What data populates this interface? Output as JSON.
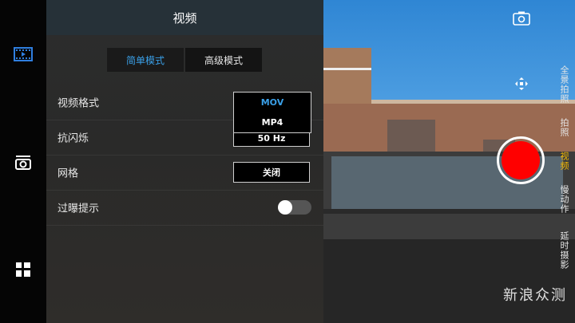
{
  "rail": {
    "items": [
      {
        "icon": "video-mode-icon"
      },
      {
        "icon": "camera-flip-icon"
      },
      {
        "icon": "grid-menu-icon"
      }
    ]
  },
  "panel": {
    "title": "视频",
    "mode_tabs": [
      {
        "label": "简单模式",
        "active": true
      },
      {
        "label": "高级模式",
        "active": false
      }
    ],
    "rows": {
      "format": {
        "label": "视频格式"
      },
      "flicker": {
        "label": "抗闪烁",
        "value": "50 Hz"
      },
      "grid": {
        "label": "网格",
        "value": "关闭"
      },
      "overexposure": {
        "label": "过曝提示",
        "toggle_on": false
      }
    },
    "format_dropdown": {
      "options": [
        "MOV",
        "MP4"
      ],
      "selected": "MOV"
    }
  },
  "camera": {
    "modes": [
      "全景拍照",
      "拍照",
      "视频",
      "慢动作",
      "延时摄影"
    ],
    "active_mode": "视频",
    "accent": "#f5b800",
    "shutter_color": "#ff0000",
    "watermark": "新浪众测"
  }
}
